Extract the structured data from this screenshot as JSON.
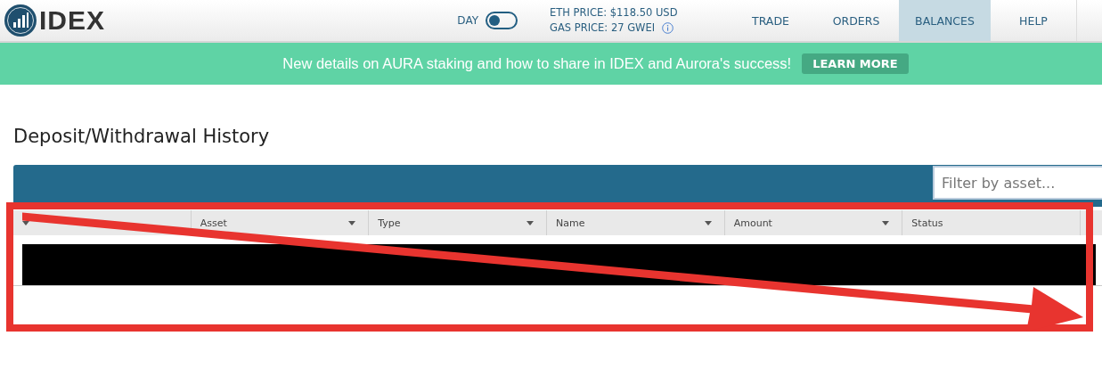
{
  "header": {
    "logo": "IDEX",
    "theme_toggle": {
      "label": "DAY",
      "on": false
    },
    "eth_price": "ETH PRICE: $118.50 USD",
    "gas_price": "GAS PRICE: 27 GWEI",
    "nav": [
      {
        "label": "TRADE",
        "selected": false
      },
      {
        "label": "ORDERS",
        "selected": false
      },
      {
        "label": "BALANCES",
        "selected": true
      },
      {
        "label": "HELP",
        "selected": false
      }
    ]
  },
  "banner": {
    "text": "New details on AURA staking and how to share in IDEX and Aurora's success!",
    "button": "LEARN MORE"
  },
  "page_title": "Deposit/Withdrawal History",
  "table": {
    "filter": {
      "placeholder": "Filter by asset..."
    },
    "columns": [
      "Asset",
      "Type",
      "Name",
      "Amount",
      "Status"
    ]
  }
}
